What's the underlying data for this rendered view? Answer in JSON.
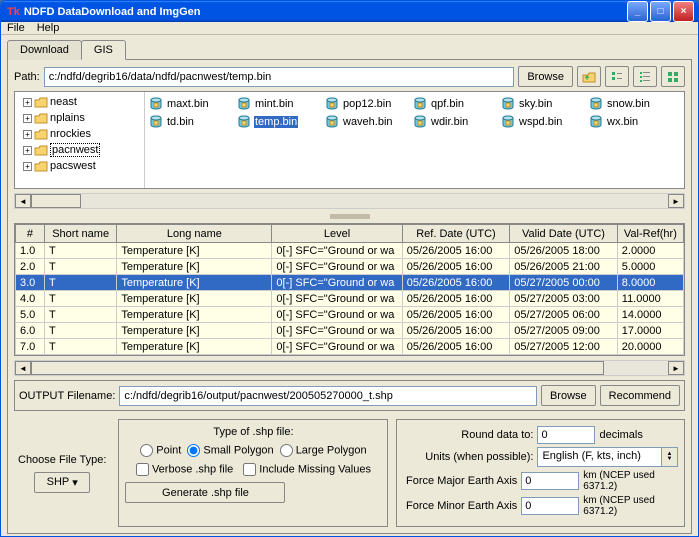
{
  "window": {
    "title": "NDFD DataDownload and ImgGen"
  },
  "menu": {
    "file": "File",
    "help": "Help"
  },
  "tabs": {
    "download": "Download",
    "gis": "GIS"
  },
  "path": {
    "label": "Path:",
    "value": "c:/ndfd/degrib16/data/ndfd/pacnwest/temp.bin",
    "browse": "Browse"
  },
  "tree": [
    {
      "label": "neast"
    },
    {
      "label": "nplains"
    },
    {
      "label": "nrockies"
    },
    {
      "label": "pacnwest",
      "selected": true
    },
    {
      "label": "pacswest"
    }
  ],
  "files": [
    {
      "name": "maxt.bin"
    },
    {
      "name": "mint.bin"
    },
    {
      "name": "pop12.bin"
    },
    {
      "name": "qpf.bin"
    },
    {
      "name": "sky.bin"
    },
    {
      "name": "snow.bin"
    },
    {
      "name": "td.bin"
    },
    {
      "name": "temp.bin",
      "selected": true
    },
    {
      "name": "waveh.bin"
    },
    {
      "name": "wdir.bin"
    },
    {
      "name": "wspd.bin"
    },
    {
      "name": "wx.bin"
    }
  ],
  "grid": {
    "headers": [
      "#",
      "Short name",
      "Long name",
      "Level",
      "Ref. Date (UTC)",
      "Valid Date (UTC)",
      "Val-Ref(hr)"
    ],
    "rows": [
      {
        "cells": [
          "1.0",
          "T",
          "Temperature [K]",
          "0[-] SFC=\"Ground or wa",
          "05/26/2005 16:00",
          "05/26/2005 18:00",
          "2.0000"
        ]
      },
      {
        "cells": [
          "2.0",
          "T",
          "Temperature [K]",
          "0[-] SFC=\"Ground or wa",
          "05/26/2005 16:00",
          "05/26/2005 21:00",
          "5.0000"
        ]
      },
      {
        "cells": [
          "3.0",
          "T",
          "Temperature [K]",
          "0[-] SFC=\"Ground or wa",
          "05/26/2005 16:00",
          "05/27/2005 00:00",
          "8.0000"
        ],
        "selected": true
      },
      {
        "cells": [
          "4.0",
          "T",
          "Temperature [K]",
          "0[-] SFC=\"Ground or wa",
          "05/26/2005 16:00",
          "05/27/2005 03:00",
          "11.0000"
        ]
      },
      {
        "cells": [
          "5.0",
          "T",
          "Temperature [K]",
          "0[-] SFC=\"Ground or wa",
          "05/26/2005 16:00",
          "05/27/2005 06:00",
          "14.0000"
        ]
      },
      {
        "cells": [
          "6.0",
          "T",
          "Temperature [K]",
          "0[-] SFC=\"Ground or wa",
          "05/26/2005 16:00",
          "05/27/2005 09:00",
          "17.0000"
        ]
      },
      {
        "cells": [
          "7.0",
          "T",
          "Temperature [K]",
          "0[-] SFC=\"Ground or wa",
          "05/26/2005 16:00",
          "05/27/2005 12:00",
          "20.0000"
        ]
      }
    ]
  },
  "output": {
    "label": "OUTPUT Filename:",
    "value": "c:/ndfd/degrib16/output/pacnwest/200505270000_t.shp",
    "browse": "Browse",
    "recommend": "Recommend"
  },
  "filetype": {
    "label": "Choose File Type:",
    "button": "SHP",
    "group_title": "Type of .shp file:",
    "point": "Point",
    "small_poly": "Small Polygon",
    "large_poly": "Large Polygon",
    "verbose": "Verbose .shp file",
    "include_missing": "Include Missing Values",
    "generate": "Generate .shp file"
  },
  "right": {
    "round_label": "Round data to:",
    "round_value": "0",
    "round_unit": "decimals",
    "units_label": "Units (when possible):",
    "units_value": "English (F, kts, inch)",
    "major_label": "Force Major Earth Axis",
    "major_value": "0",
    "major_note": "km (NCEP used 6371.2)",
    "minor_label": "Force Minor Earth Axis",
    "minor_value": "0",
    "minor_note": "km (NCEP used 6371.2)"
  }
}
